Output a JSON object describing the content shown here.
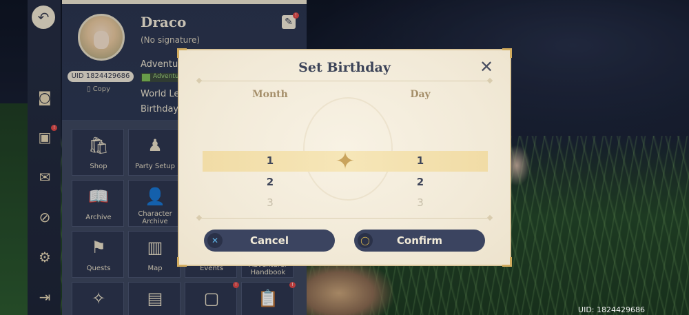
{
  "profile": {
    "name": "Draco",
    "signature": "(No signature)",
    "uid_pill": "UID 1824429686",
    "copy_label": "Copy",
    "adventure_rank_label": "Adventu",
    "adventure_badge_text": "Adventu",
    "world_level_label": "World Le",
    "birthday_label": "Birthday"
  },
  "menu": {
    "tiles": [
      {
        "label": "Shop",
        "icon": "shop-bag-icon"
      },
      {
        "label": "Party Setup",
        "icon": "party-icon"
      },
      {
        "label": "Archive",
        "icon": "archive-book-icon"
      },
      {
        "label": "Character Archive",
        "icon": "character-card-icon"
      },
      {
        "label": "Quests",
        "icon": "quest-banner-icon"
      },
      {
        "label": "Map",
        "icon": "map-icon"
      },
      {
        "label": "Events",
        "icon": "events-icon"
      },
      {
        "label": "Adventurer Handbook",
        "icon": "handbook-icon"
      }
    ]
  },
  "dialog": {
    "title": "Set Birthday",
    "month_header": "Month",
    "day_header": "Day",
    "month_values": [
      "1",
      "2",
      "3"
    ],
    "day_values": [
      "1",
      "2",
      "3"
    ],
    "selected_month": "1",
    "selected_day": "1",
    "cancel_label": "Cancel",
    "confirm_label": "Confirm"
  },
  "footer": {
    "uid": "UID: 1824429686"
  },
  "colors": {
    "dialog_bg": "#f4eddc",
    "accent_gold": "#d2ac5f",
    "button_bg": "#3b4460",
    "selection_band": "#f3e0ae"
  }
}
